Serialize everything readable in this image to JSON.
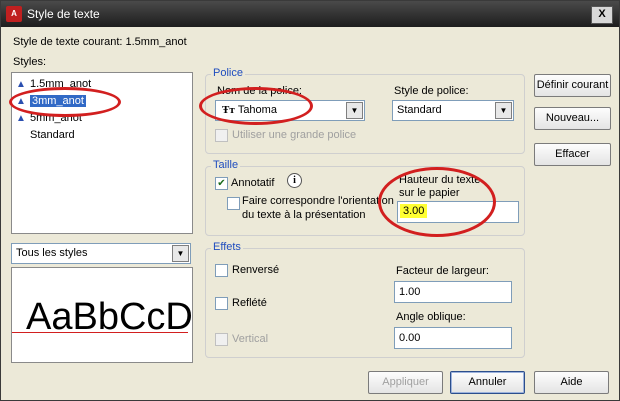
{
  "window": {
    "title": "Style de texte",
    "app_icon_label": "A",
    "close_label": "X"
  },
  "current_style": "Style de texte courant:  1.5mm_anot",
  "styles_label": "Styles:",
  "styles_list": [
    {
      "label": "1.5mm_anot",
      "icon": "annotative-icon"
    },
    {
      "label": "3mm_anot",
      "icon": "annotative-icon",
      "selected": true
    },
    {
      "label": "5mm_anot",
      "icon": "annotative-icon"
    },
    {
      "label": "Standard",
      "icon": ""
    }
  ],
  "filter": {
    "value": "Tous les styles"
  },
  "preview": {
    "text": "AaBbCcD"
  },
  "police": {
    "title": "Police",
    "font_name_label": "Nom de la police:",
    "font_name_value": "Tahoma",
    "font_style_label": "Style de police:",
    "font_style_value": "Standard",
    "big_font_label": "Utiliser une grande police"
  },
  "taille": {
    "title": "Taille",
    "annotative_label": "Annotatif",
    "match_orientation_label_1": "Faire correspondre l'orientation",
    "match_orientation_label_2": "du texte à la présentation",
    "height_label_1": "Hauteur du texte",
    "height_label_2": "sur le papier",
    "height_value": "3.00"
  },
  "effets": {
    "title": "Effets",
    "upside_down_label": "Renversé",
    "backwards_label": "Reflété",
    "vertical_label": "Vertical",
    "width_factor_label": "Facteur de largeur:",
    "width_factor_value": "1.00",
    "oblique_angle_label": "Angle oblique:",
    "oblique_angle_value": "0.00"
  },
  "buttons": {
    "set_current": "Définir courant",
    "new": "Nouveau...",
    "delete": "Effacer",
    "apply": "Appliquer",
    "cancel": "Annuler",
    "help": "Aide"
  },
  "colors": {
    "highlight_ellipse": "#d21f1f",
    "selection": "#3169c6",
    "group_title": "#1f4dbf",
    "height_field_bg": "#ffff33"
  }
}
